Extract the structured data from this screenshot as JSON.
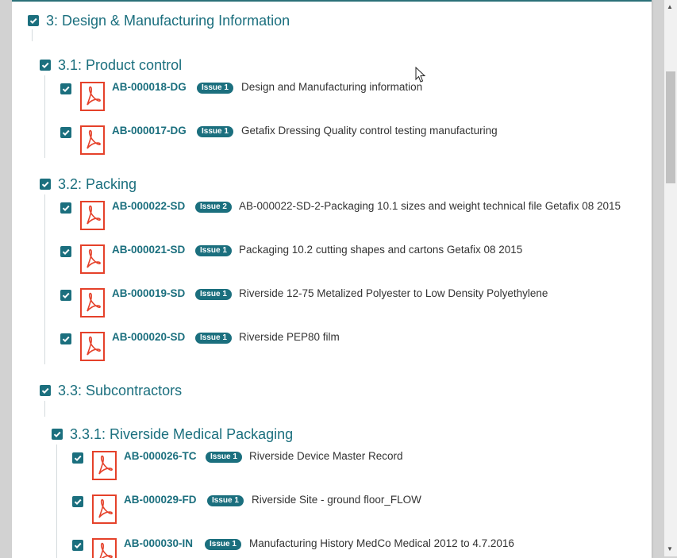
{
  "sections": {
    "s3": {
      "title": "3: Design & Manufacturing Information"
    },
    "s31": {
      "title": "3.1: Product control"
    },
    "s32": {
      "title": "3.2: Packing"
    },
    "s33": {
      "title": "3.3: Subcontractors"
    },
    "s331": {
      "title": "3.3.1: Riverside Medical Packaging"
    }
  },
  "docs": [
    {
      "code": "AB-000018-DG",
      "issue": "Issue 1",
      "description": "Design and Manufacturing information"
    },
    {
      "code": "AB-000017-DG",
      "issue": "Issue 1",
      "description": "Getafix Dressing Quality control testing manufacturing"
    },
    {
      "code": "AB-000022-SD",
      "issue": "Issue 2",
      "description": "AB-000022-SD-2-Packaging 10.1 sizes and weight technical file Getafix 08 2015"
    },
    {
      "code": "AB-000021-SD",
      "issue": "Issue 1",
      "description": "Packaging 10.2 cutting shapes and cartons Getafix 08 2015"
    },
    {
      "code": "AB-000019-SD",
      "issue": "Issue 1",
      "description": "Riverside 12-75 Metalized Polyester to Low Density Polyethylene"
    },
    {
      "code": "AB-000020-SD",
      "issue": "Issue 1",
      "description": "Riverside PEP80 film"
    },
    {
      "code": "AB-000026-TC",
      "issue": "Issue 1",
      "description": "Riverside Device Master Record"
    },
    {
      "code": "AB-000029-FD",
      "issue": "Issue 1",
      "description": "Riverside Site - ground floor_FLOW"
    },
    {
      "code": "AB-000030-IN",
      "issue": "Issue 1",
      "description": "Manufacturing History MedCo Medical 2012 to 4.7.2016"
    }
  ],
  "colors": {
    "accent": "#1b6f7e",
    "pdf_red": "#e5412a",
    "text": "#333333"
  },
  "icons": {
    "checkbox": "checkbox-checked-icon",
    "pdf": "pdf-file-icon",
    "cursor": "mouse-cursor-icon"
  },
  "all_checked": true
}
